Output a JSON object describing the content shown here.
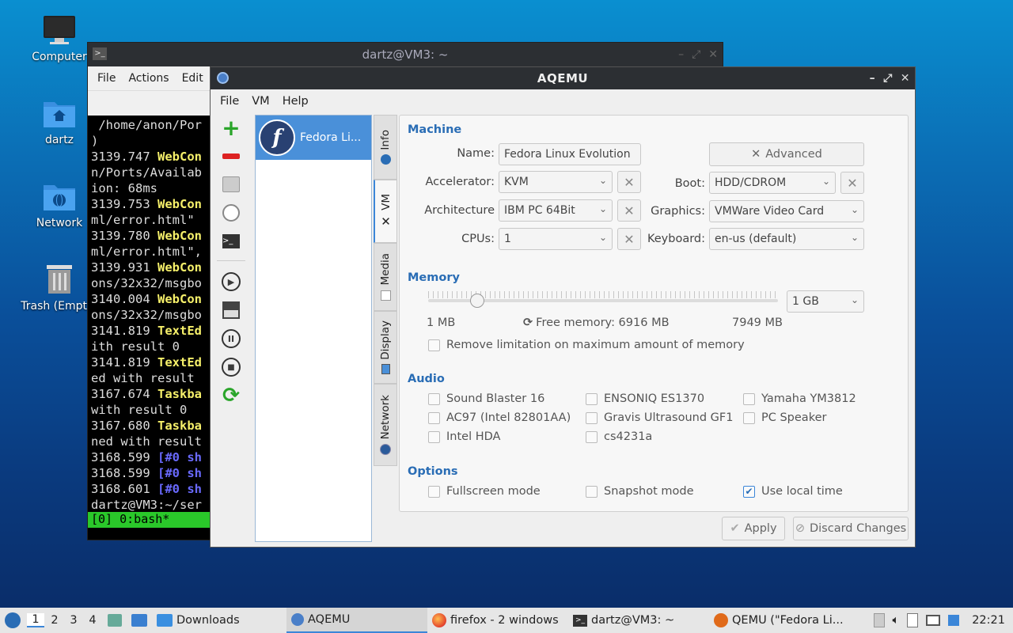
{
  "desktop": {
    "icons": [
      {
        "label": "Computer",
        "icon": "computer-icon"
      },
      {
        "label": "dartz",
        "icon": "home-folder-icon"
      },
      {
        "label": "Network",
        "icon": "network-folder-icon"
      },
      {
        "label": "Trash (Empty)",
        "icon": "trash-icon"
      }
    ]
  },
  "terminal": {
    "title": "dartz@VM3: ~",
    "menu": [
      "File",
      "Actions",
      "Edit"
    ],
    "lines": [
      [
        {
          "t": " /home/anon/Por"
        }
      ],
      [
        {
          "t": ")"
        }
      ],
      [
        {
          "t": "3139.747 "
        },
        {
          "t": "WebCon",
          "c": "yl"
        }
      ],
      [
        {
          "t": "n/Ports/Availab"
        }
      ],
      [
        {
          "t": "ion: 68ms"
        }
      ],
      [
        {
          "t": "3139.753 "
        },
        {
          "t": "WebCon",
          "c": "yl"
        }
      ],
      [
        {
          "t": "ml/error.html\""
        }
      ],
      [
        {
          "t": "3139.780 "
        },
        {
          "t": "WebCon",
          "c": "yl"
        }
      ],
      [
        {
          "t": "ml/error.html\","
        }
      ],
      [
        {
          "t": "3139.931 "
        },
        {
          "t": "WebCon",
          "c": "yl"
        }
      ],
      [
        {
          "t": "ons/32x32/msgbo"
        }
      ],
      [
        {
          "t": "3140.004 "
        },
        {
          "t": "WebCon",
          "c": "yl"
        }
      ],
      [
        {
          "t": "ons/32x32/msgbo"
        }
      ],
      [
        {
          "t": "3141.819 "
        },
        {
          "t": "TextEd",
          "c": "yl"
        }
      ],
      [
        {
          "t": "ith result 0"
        }
      ],
      [
        {
          "t": "3141.819 "
        },
        {
          "t": "TextEd",
          "c": "yl"
        }
      ],
      [
        {
          "t": "ed with result"
        }
      ],
      [
        {
          "t": "3167.674 "
        },
        {
          "t": "Taskba",
          "c": "yl"
        }
      ],
      [
        {
          "t": "with result 0"
        }
      ],
      [
        {
          "t": "3167.680 "
        },
        {
          "t": "Taskba",
          "c": "yl"
        }
      ],
      [
        {
          "t": "ned with result"
        }
      ],
      [
        {
          "t": "3168.599 "
        },
        {
          "t": "[#0 sh",
          "c": "bl"
        }
      ],
      [
        {
          "t": "3168.599 "
        },
        {
          "t": "[#0 sh",
          "c": "bl"
        }
      ],
      [
        {
          "t": "3168.601 "
        },
        {
          "t": "[#0 sh",
          "c": "bl"
        }
      ],
      [
        {
          "t": "dartz@VM3:~/ser"
        }
      ]
    ],
    "status": "[0] 0:bash*"
  },
  "aqemu": {
    "title": "AQEMU",
    "menu": [
      "File",
      "VM",
      "Help"
    ],
    "vm_name": "Fedora Li...",
    "tabs": [
      "Info",
      "VM",
      "Media",
      "Display",
      "Network"
    ],
    "machine": {
      "header": "Machine",
      "name_label": "Name:",
      "name_value": "Fedora Linux Evolution",
      "accel_label": "Accelerator:",
      "accel_value": "KVM",
      "arch_label": "Architecture",
      "arch_value": "IBM PC 64Bit",
      "cpus_label": "CPUs:",
      "cpus_value": "1",
      "advanced": "Advanced",
      "boot_label": "Boot:",
      "boot_value": "HDD/CDROM",
      "graphics_label": "Graphics:",
      "graphics_value": "VMWare Video Card",
      "keyboard_label": "Keyboard:",
      "keyboard_value": "en-us (default)"
    },
    "memory": {
      "header": "Memory",
      "value": "1 GB",
      "min": "1 MB",
      "free": "Free memory: 6916 MB",
      "max": "7949 MB",
      "remove_limit": "Remove limitation on maximum amount of memory",
      "slider_fraction": 0.14
    },
    "audio": {
      "header": "Audio",
      "items": [
        "Sound Blaster 16",
        "ENSONIQ ES1370",
        "Yamaha YM3812",
        "AC97 (Intel 82801AA)",
        "Gravis Ultrasound GF1",
        "PC Speaker",
        "Intel HDA",
        "cs4231a"
      ]
    },
    "options": {
      "header": "Options",
      "fullscreen": "Fullscreen mode",
      "snapshot": "Snapshot mode",
      "localtime": "Use local time",
      "localtime_checked": true
    },
    "apply": "Apply",
    "discard": "Discard Changes"
  },
  "taskbar": {
    "workspaces": [
      "1",
      "2",
      "3",
      "4"
    ],
    "downloads": "Downloads",
    "tasks": [
      "AQEMU",
      "firefox - 2 windows",
      "dartz@VM3: ~",
      "QEMU (\"Fedora Li..."
    ],
    "clock": "22:21"
  },
  "colors": {
    "accent": "#2a6db5",
    "selection": "#4a90d9",
    "terminal_status": "#2ac82a"
  }
}
